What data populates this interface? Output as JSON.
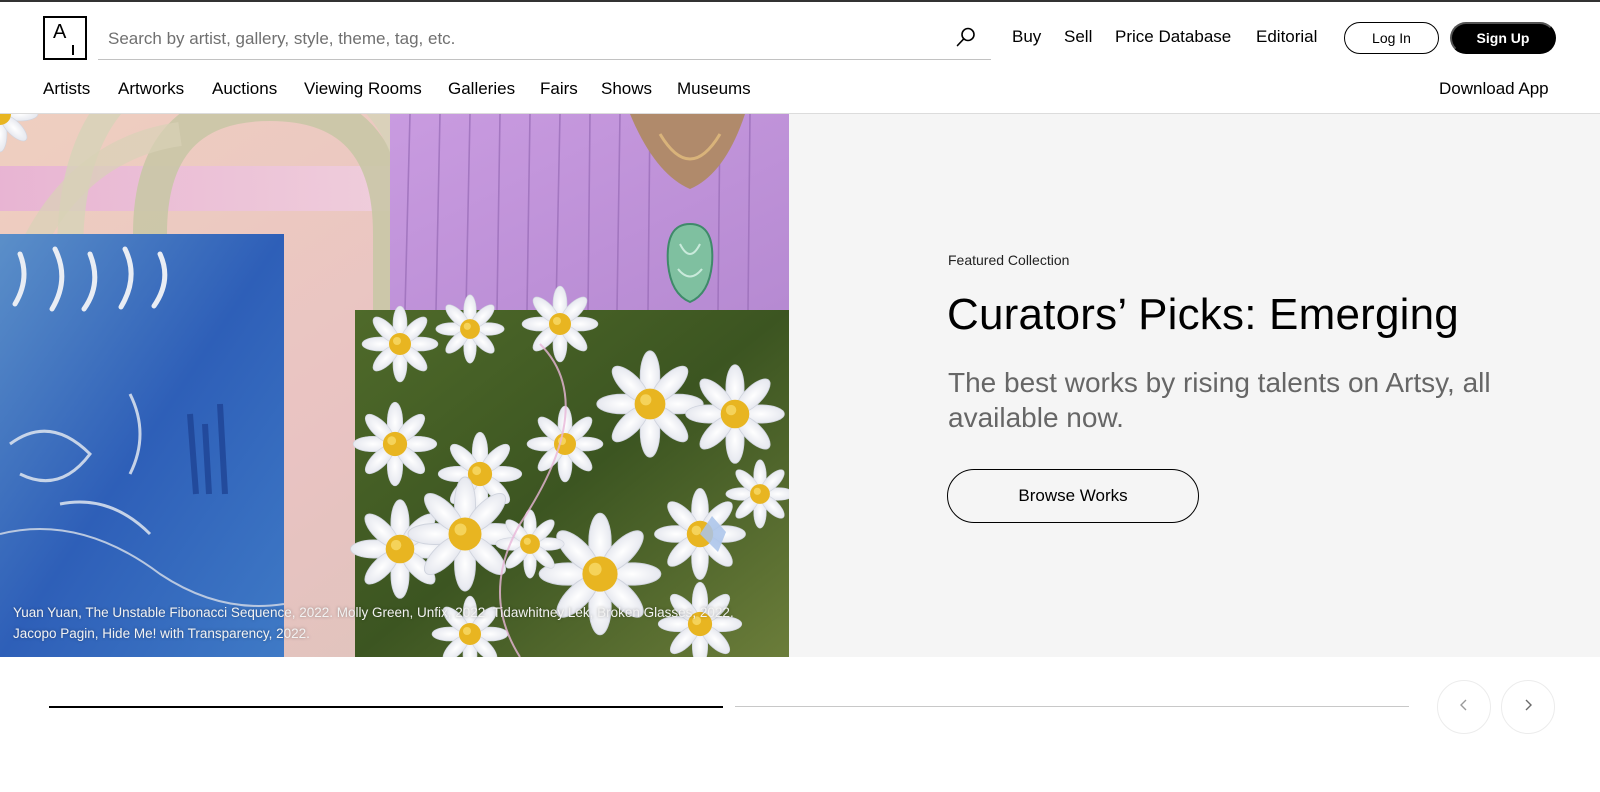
{
  "header": {
    "logo_letter": "A",
    "search": {
      "placeholder": "Search by artist, gallery, style, theme, tag, etc.",
      "icon": "search-icon"
    },
    "top_nav": [
      "Buy",
      "Sell",
      "Price Database",
      "Editorial"
    ],
    "login_label": "Log In",
    "signup_label": "Sign Up",
    "sub_nav": [
      "Artists",
      "Artworks",
      "Auctions",
      "Viewing Rooms",
      "Galleries",
      "Fairs",
      "Shows",
      "Museums"
    ],
    "download_app": "Download App"
  },
  "hero": {
    "caption_line1": "Yuan Yuan, The Unstable Fibonacci Sequence, 2022. Molly Green, Unfix, 2022. Tidawhitney Lek, Broken Glasses, 2022.",
    "caption_line2": "Jacopo Pagin, Hide Me! with Transparency, 2022.",
    "eyebrow": "Featured Collection",
    "title": "Curators’ Picks: Emerging",
    "subtitle": "The best works by rising talents on Artsy, all available now.",
    "cta_label": "Browse Works"
  },
  "carousel": {
    "slide_count": 2,
    "active_slide": 1,
    "prev_icon": "chevron-left-icon",
    "next_icon": "chevron-right-icon"
  },
  "colors": {
    "hero_background": "#f5f5f5",
    "signup_background": "#000000",
    "subtitle_text": "#666666"
  }
}
